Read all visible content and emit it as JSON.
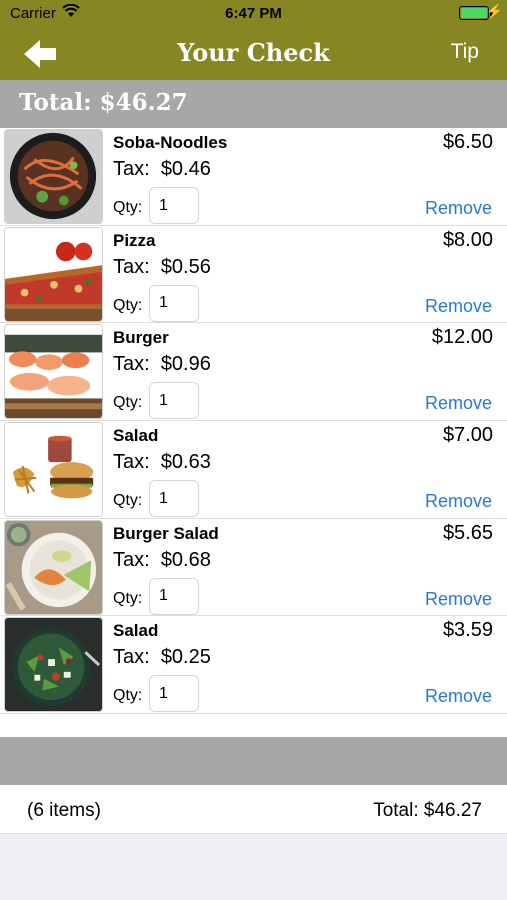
{
  "status_bar": {
    "carrier": "Carrier",
    "time": "6:47 PM",
    "battery_level": 1.0
  },
  "nav": {
    "title": "Your Check",
    "tip_label": "Tip",
    "back_icon": "back-arrow-icon"
  },
  "total_bar": {
    "text": "Total: $46.27"
  },
  "items": [
    {
      "name": "Soba-Noodles",
      "price": "$6.50",
      "tax_label": "Tax:",
      "tax": "$0.46",
      "qty_label": "Qty:",
      "qty": "1",
      "remove_label": "Remove"
    },
    {
      "name": "Pizza",
      "price": "$8.00",
      "tax_label": "Tax:",
      "tax": "$0.56",
      "qty_label": "Qty:",
      "qty": "1",
      "remove_label": "Remove"
    },
    {
      "name": "Burger",
      "price": "$12.00",
      "tax_label": "Tax:",
      "tax": "$0.96",
      "qty_label": "Qty:",
      "qty": "1",
      "remove_label": "Remove"
    },
    {
      "name": "Salad",
      "price": "$7.00",
      "tax_label": "Tax:",
      "tax": "$0.63",
      "qty_label": "Qty:",
      "qty": "1",
      "remove_label": "Remove"
    },
    {
      "name": "Burger Salad",
      "price": "$5.65",
      "tax_label": "Tax:",
      "tax": "$0.68",
      "qty_label": "Qty:",
      "qty": "1",
      "remove_label": "Remove"
    },
    {
      "name": "Salad",
      "price": "$3.59",
      "tax_label": "Tax:",
      "tax": "$0.25",
      "qty_label": "Qty:",
      "qty": "1",
      "remove_label": "Remove"
    }
  ],
  "footer": {
    "count": "(6 items)",
    "total": "Total: $46.27"
  },
  "colors": {
    "nav_bg": "#868722",
    "gray_bar": "#a7a7a7",
    "link_blue": "#2a78d4",
    "battery_green": "#4cd964"
  }
}
